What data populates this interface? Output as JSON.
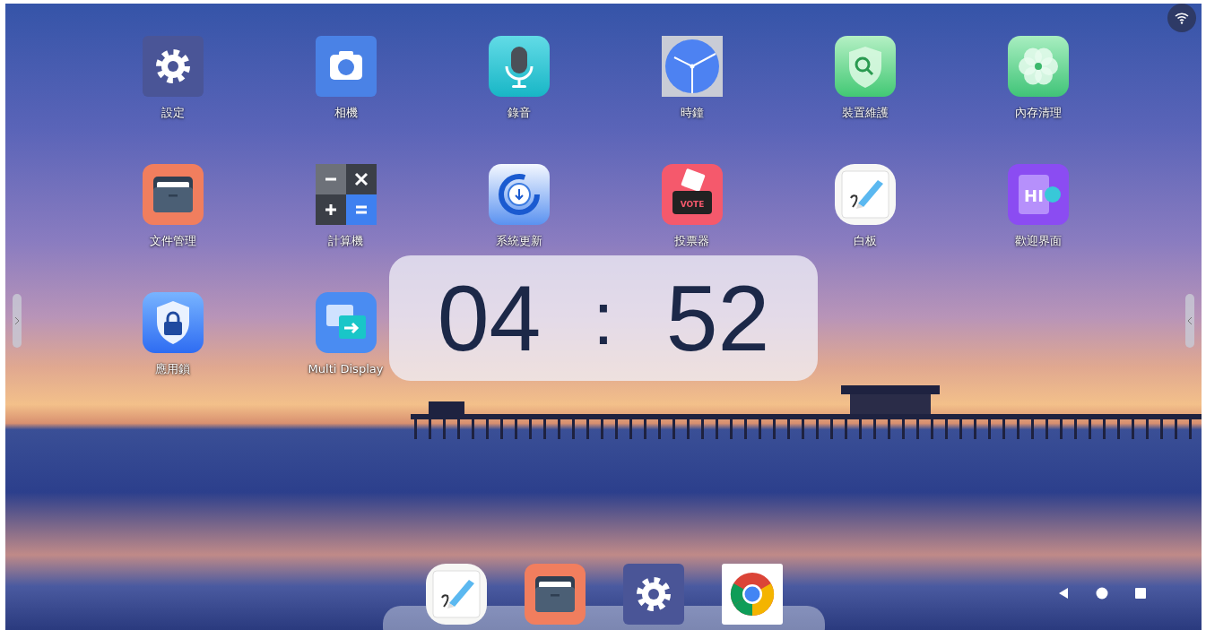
{
  "apps": [
    {
      "label": "設定",
      "kind": "settings"
    },
    {
      "label": "相機",
      "kind": "camera"
    },
    {
      "label": "錄音",
      "kind": "recorder"
    },
    {
      "label": "時鐘",
      "kind": "clock"
    },
    {
      "label": "裝置維護",
      "kind": "shield-search"
    },
    {
      "label": "內存清理",
      "kind": "flower"
    },
    {
      "label": "文件管理",
      "kind": "folder"
    },
    {
      "label": "計算機",
      "kind": "calculator"
    },
    {
      "label": "系統更新",
      "kind": "update"
    },
    {
      "label": "投票器",
      "kind": "vote",
      "icon_text": "VOTE"
    },
    {
      "label": "白板",
      "kind": "whiteboard"
    },
    {
      "label": "歡迎界面",
      "kind": "welcome",
      "icon_text": "HI"
    },
    {
      "label": "應用鎖",
      "kind": "lock"
    },
    {
      "label": "Multi Display",
      "kind": "multidisplay"
    }
  ],
  "clock_widget": {
    "hours": "04",
    "separator": ":",
    "minutes": "52"
  },
  "dock": [
    {
      "kind": "whiteboard"
    },
    {
      "kind": "folder"
    },
    {
      "kind": "settings"
    },
    {
      "kind": "chrome"
    }
  ],
  "navigation": [
    {
      "kind": "back"
    },
    {
      "kind": "home"
    },
    {
      "kind": "recents"
    }
  ]
}
